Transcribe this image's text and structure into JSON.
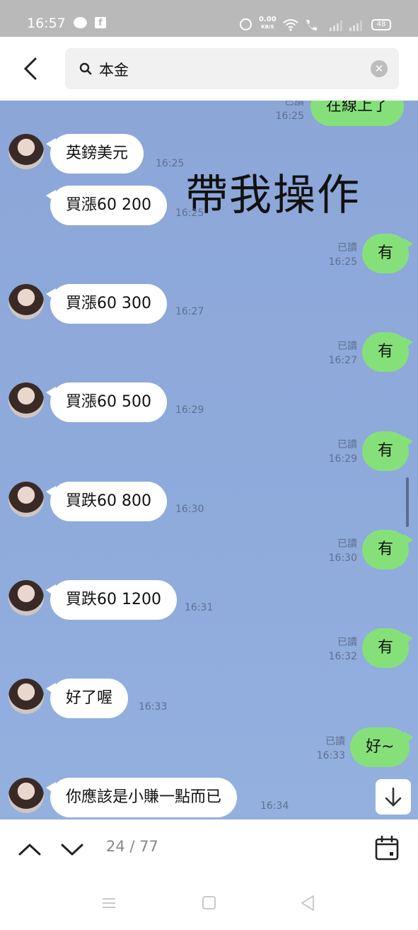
{
  "status_bar": {
    "time": "16:57",
    "speed_value": "0.00",
    "speed_unit": "KB/S",
    "battery": "48",
    "icons": [
      "line-icon",
      "facebook-icon",
      "alarm-icon",
      "wifi-icon",
      "volte-call-icon",
      "signal-icon",
      "signal-icon-2",
      "battery-icon"
    ]
  },
  "search": {
    "query": "本金",
    "icons": [
      "back-arrow-icon",
      "search-icon",
      "clear-icon"
    ]
  },
  "overlay_caption": "帶我操作",
  "messages": {
    "m0_text": "在線上了",
    "m0_read": "已讀",
    "m0_time": "16:25",
    "m1_text": "英鎊美元",
    "m1_time": "16:25",
    "m2_text": "買漲60 200",
    "m2_time": "16:25",
    "m3_text": "有",
    "m3_read": "已讀",
    "m3_time": "16:25",
    "m4_text": "買漲60 300",
    "m4_time": "16:27",
    "m5_text": "有",
    "m5_read": "已讀",
    "m5_time": "16:27",
    "m6_text": "買漲60 500",
    "m6_time": "16:29",
    "m7_text": "有",
    "m7_read": "已讀",
    "m7_time": "16:29",
    "m8_text": "買跌60 800",
    "m8_time": "16:30",
    "m9_text": "有",
    "m9_read": "已讀",
    "m9_time": "16:30",
    "m10_text": "買跌60 1200",
    "m10_time": "16:31",
    "m11_text": "有",
    "m11_read": "已讀",
    "m11_time": "16:32",
    "m12_text": "好了喔",
    "m12_time": "16:33",
    "m13_text": "好~",
    "m13_read": "已讀",
    "m13_time": "16:33",
    "m14_text": "你應該是小賺一點而已",
    "m14_time": "16:34"
  },
  "bottom_bar": {
    "counter": "24 / 77",
    "icons": [
      "chevron-up-icon",
      "chevron-down-icon",
      "calendar-icon",
      "scroll-down-arrow-icon"
    ]
  },
  "system_nav": {
    "icons": [
      "menu-icon",
      "home-icon",
      "back-triangle-icon"
    ]
  },
  "colors": {
    "chat_background": "#8ca6d8",
    "incoming_bubble": "#ffffff",
    "outgoing_bubble": "#86e07a",
    "status_bar": "#b9b9b9"
  }
}
